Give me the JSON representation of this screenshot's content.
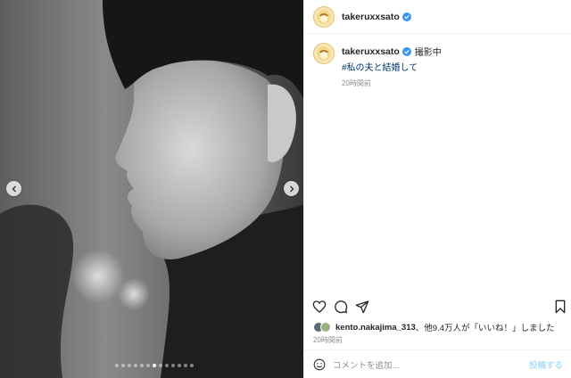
{
  "account": {
    "username": "takeruxxsato",
    "verified": true
  },
  "caption": {
    "username": "takeruxxsato",
    "text": "撮影中",
    "hashtag": "#私の夫と結婚して",
    "time": "20時間前"
  },
  "media": {
    "dots_total": 13,
    "dots_active_index": 6
  },
  "likes": {
    "liker": "kento.nakajima_313",
    "text": "、他9.4万人が「いいね！」しました"
  },
  "post_time": "20時間前",
  "comment": {
    "placeholder": "コメントを追加...",
    "post_label": "投稿する"
  },
  "icons": [
    "carousel-prev-icon",
    "carousel-next-icon",
    "verified-badge-icon",
    "heart-icon",
    "comment-icon",
    "share-icon",
    "bookmark-icon",
    "emoji-icon"
  ],
  "colors": {
    "link": "#00376b",
    "verified": "#3897f0",
    "muted": "#8e8e8e",
    "post_button": "#b2dffc"
  }
}
